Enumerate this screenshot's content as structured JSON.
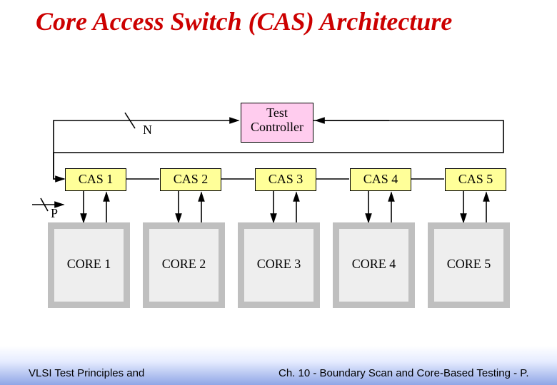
{
  "title": "Core Access Switch (CAS) Architecture",
  "test_controller": "Test\nController",
  "bus_label_n": "N",
  "bus_label_p": "P",
  "cas": [
    "CAS 1",
    "CAS 2",
    "CAS 3",
    "CAS 4",
    "CAS 5"
  ],
  "core": [
    "CORE 1",
    "CORE 2",
    "CORE 3",
    "CORE 4",
    "CORE 5"
  ],
  "footer_left": "VLSI Test Principles and",
  "footer_right": "Ch. 10 - Boundary Scan and Core-Based Testing - P."
}
